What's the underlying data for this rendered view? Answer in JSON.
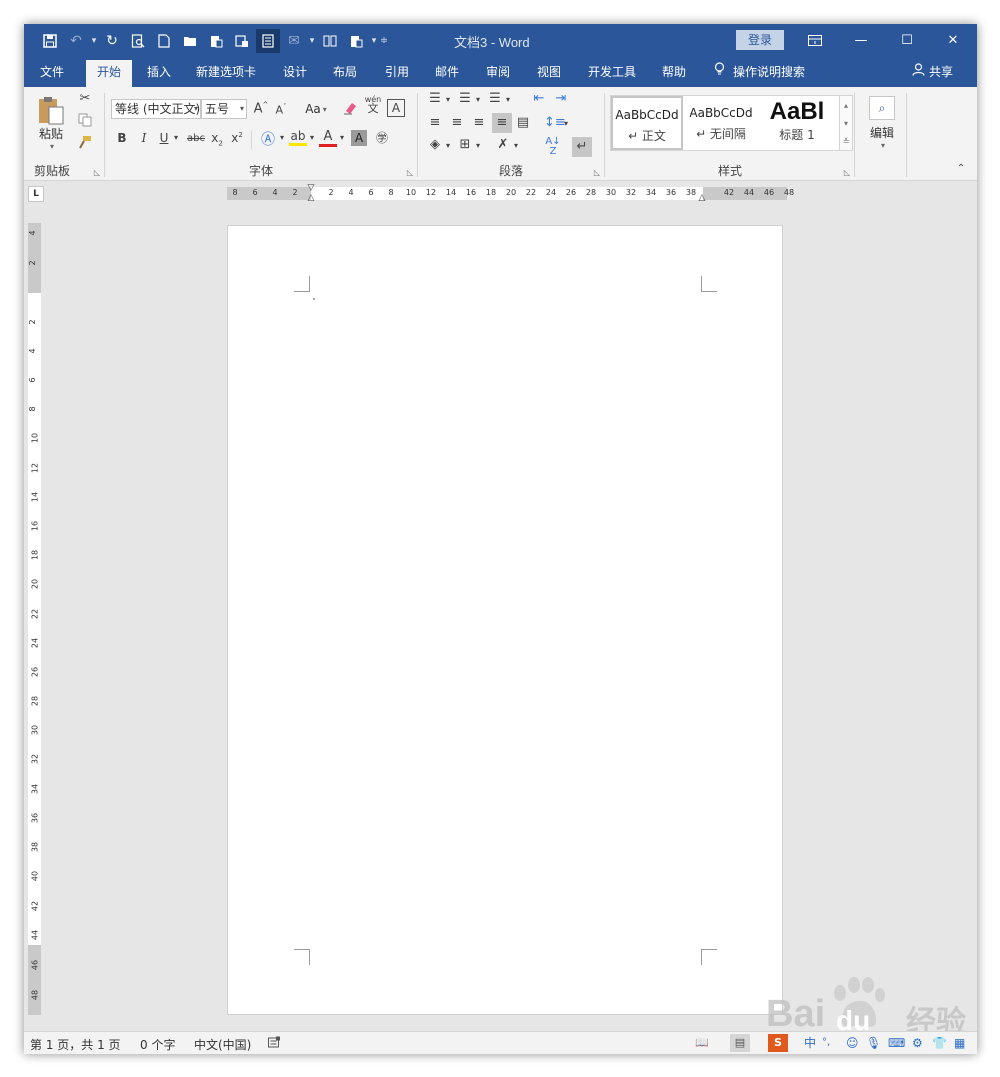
{
  "titlebar": {
    "doc_title": "文档3 - Word",
    "login_label": "登录",
    "bg_color": "#2b579a"
  },
  "tabs": [
    {
      "label": "文件"
    },
    {
      "label": "开始"
    },
    {
      "label": "插入"
    },
    {
      "label": "新建选项卡"
    },
    {
      "label": "设计"
    },
    {
      "label": "布局"
    },
    {
      "label": "引用"
    },
    {
      "label": "邮件"
    },
    {
      "label": "审阅"
    },
    {
      "label": "视图"
    },
    {
      "label": "开发工具"
    },
    {
      "label": "帮助"
    }
  ],
  "tell_me": "操作说明搜索",
  "share_label": "共享",
  "ribbon": {
    "clipboard": {
      "paste_label": "粘贴",
      "group_label": "剪贴板"
    },
    "font": {
      "font_name": "等线 (中文正文)",
      "font_size": "五号",
      "case_label": "Aa",
      "group_label": "字体",
      "phonetic_top": "wén",
      "phonetic_bottom": "文"
    },
    "paragraph": {
      "group_label": "段落"
    },
    "styles": {
      "items": [
        {
          "preview": "AaBbCcDd",
          "name": "↵ 正文"
        },
        {
          "preview": "AaBbCcDd",
          "name": "↵ 无间隔"
        },
        {
          "preview": "AaBl",
          "name": "标题 1"
        }
      ],
      "group_label": "样式"
    },
    "editing": {
      "label": "编辑"
    }
  },
  "ruler": {
    "tab_selector": "L",
    "h_ticks": [
      "8",
      "6",
      "4",
      "2",
      "2",
      "4",
      "6",
      "8",
      "10",
      "12",
      "14",
      "16",
      "18",
      "20",
      "22",
      "24",
      "26",
      "28",
      "30",
      "32",
      "34",
      "36",
      "38",
      "42",
      "44",
      "46",
      "48"
    ],
    "v_ticks": [
      "4",
      "2",
      "2",
      "4",
      "6",
      "8",
      "10",
      "12",
      "14",
      "16",
      "18",
      "20",
      "22",
      "24",
      "26",
      "28",
      "30",
      "32",
      "34",
      "36",
      "38",
      "40",
      "42",
      "44",
      "46",
      "48"
    ]
  },
  "statusbar": {
    "page": "第 1 页，共 1 页",
    "words": "0 个字",
    "language": "中文(中国)"
  },
  "watermark": {
    "brand": "Bai",
    "brand_du": "du",
    "suffix": "经验"
  }
}
